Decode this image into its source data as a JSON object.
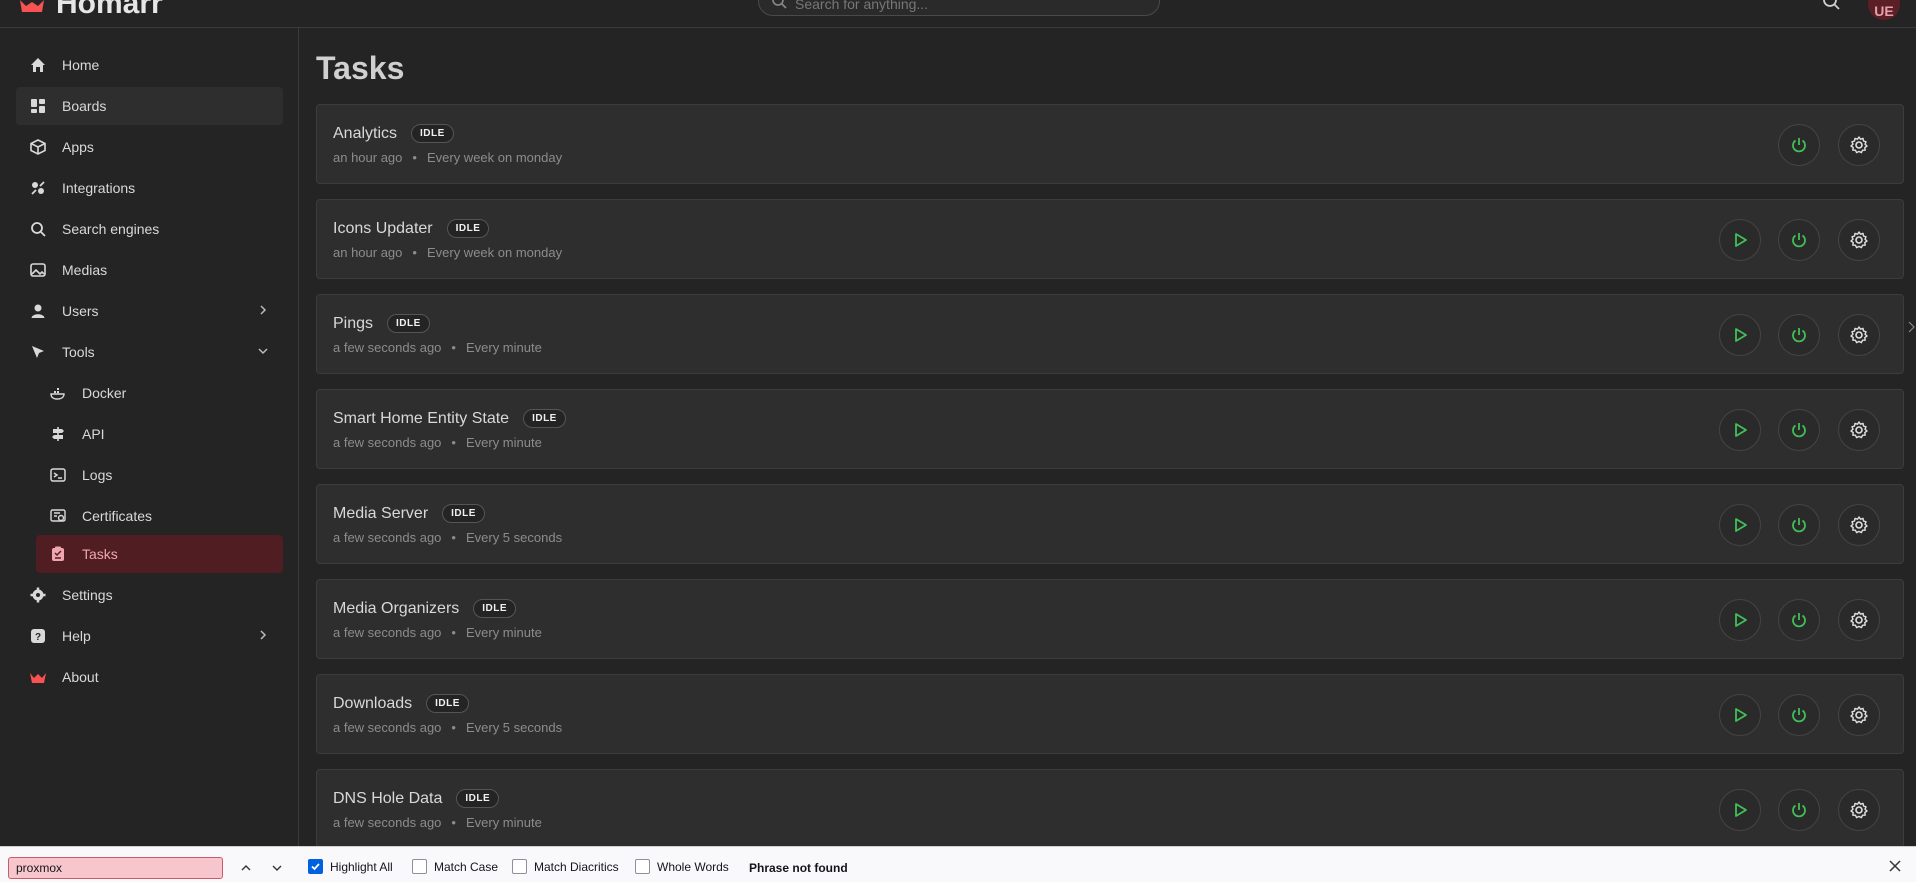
{
  "header": {
    "app_name": "Homarr",
    "search_placeholder": "Search for anything...",
    "avatar_initials": "UE"
  },
  "sidebar": {
    "items": [
      {
        "label": "Home",
        "icon": "home-icon"
      },
      {
        "label": "Boards",
        "icon": "boards-icon"
      },
      {
        "label": "Apps",
        "icon": "box-icon"
      },
      {
        "label": "Integrations",
        "icon": "plug-icon"
      },
      {
        "label": "Search engines",
        "icon": "search-icon"
      },
      {
        "label": "Medias",
        "icon": "photo-icon"
      },
      {
        "label": "Users",
        "icon": "user-icon"
      },
      {
        "label": "Tools",
        "icon": "pointer-icon"
      },
      {
        "label": "Docker",
        "icon": "docker-icon"
      },
      {
        "label": "API",
        "icon": "api-icon"
      },
      {
        "label": "Logs",
        "icon": "terminal-icon"
      },
      {
        "label": "Certificates",
        "icon": "certificate-icon"
      },
      {
        "label": "Tasks",
        "icon": "tasks-icon"
      },
      {
        "label": "Settings",
        "icon": "gear-icon"
      },
      {
        "label": "Help",
        "icon": "help-icon"
      },
      {
        "label": "About",
        "icon": "logo-icon"
      }
    ]
  },
  "main": {
    "title": "Tasks",
    "tasks": [
      {
        "name": "Analytics",
        "status": "IDLE",
        "last_run": "an hour ago",
        "schedule": "Every week on monday",
        "has_play": false
      },
      {
        "name": "Icons Updater",
        "status": "IDLE",
        "last_run": "an hour ago",
        "schedule": "Every week on monday",
        "has_play": true
      },
      {
        "name": "Pings",
        "status": "IDLE",
        "last_run": "a few seconds ago",
        "schedule": "Every minute",
        "has_play": true
      },
      {
        "name": "Smart Home Entity State",
        "status": "IDLE",
        "last_run": "a few seconds ago",
        "schedule": "Every minute",
        "has_play": true
      },
      {
        "name": "Media Server",
        "status": "IDLE",
        "last_run": "a few seconds ago",
        "schedule": "Every 5 seconds",
        "has_play": true
      },
      {
        "name": "Media Organizers",
        "status": "IDLE",
        "last_run": "a few seconds ago",
        "schedule": "Every minute",
        "has_play": true
      },
      {
        "name": "Downloads",
        "status": "IDLE",
        "last_run": "a few seconds ago",
        "schedule": "Every 5 seconds",
        "has_play": true
      },
      {
        "name": "DNS Hole Data",
        "status": "IDLE",
        "last_run": "a few seconds ago",
        "schedule": "Every minute",
        "has_play": true
      }
    ]
  },
  "findbar": {
    "query": "proxmox",
    "highlight_all": "Highlight All",
    "match_case": "Match Case",
    "match_diacritics": "Match Diacritics",
    "whole_words": "Whole Words",
    "status": "Phrase not found"
  },
  "colors": {
    "accent": "#fa5252",
    "success": "#40c057",
    "active_bg": "#4f1d22"
  }
}
